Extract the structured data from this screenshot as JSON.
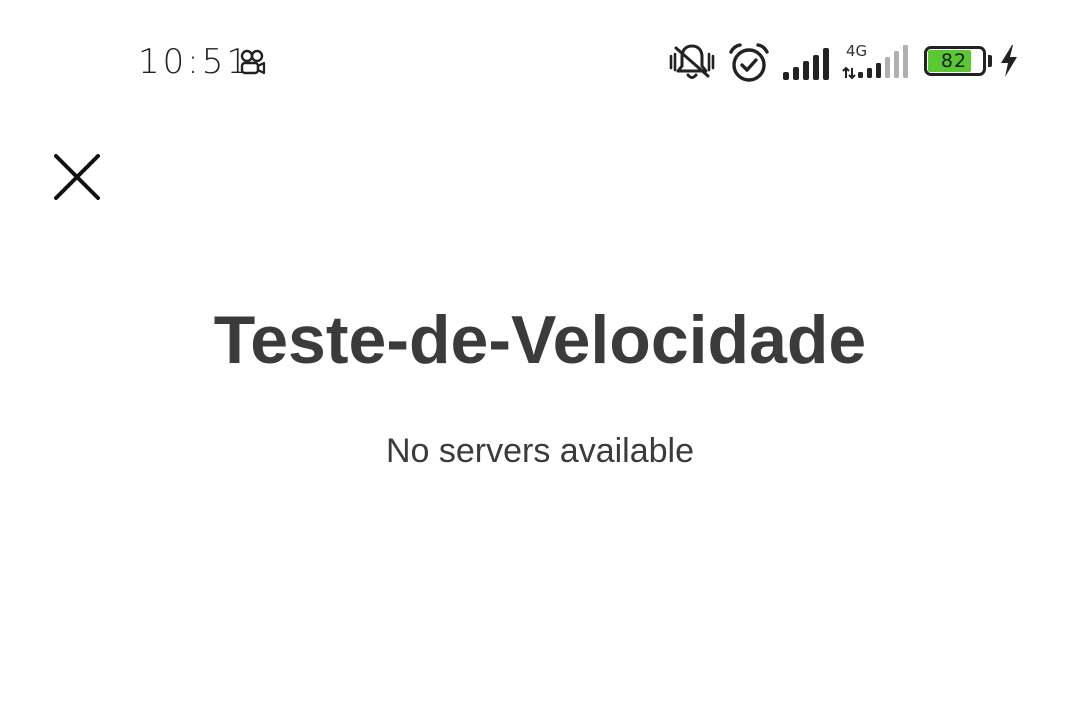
{
  "status_bar": {
    "time": "10:51",
    "battery_level": "82",
    "network_type": "4G",
    "icons": [
      "app-notification-icon",
      "vibrate-off-icon",
      "alarm-icon",
      "signal-icon",
      "signal-4g-icon",
      "battery-icon",
      "charging-bolt-icon"
    ],
    "battery_color": "#5ac832"
  },
  "toolbar": {
    "close_icon": "close-icon"
  },
  "main": {
    "title": "Teste-de-Velocidade",
    "message": "No servers available"
  }
}
